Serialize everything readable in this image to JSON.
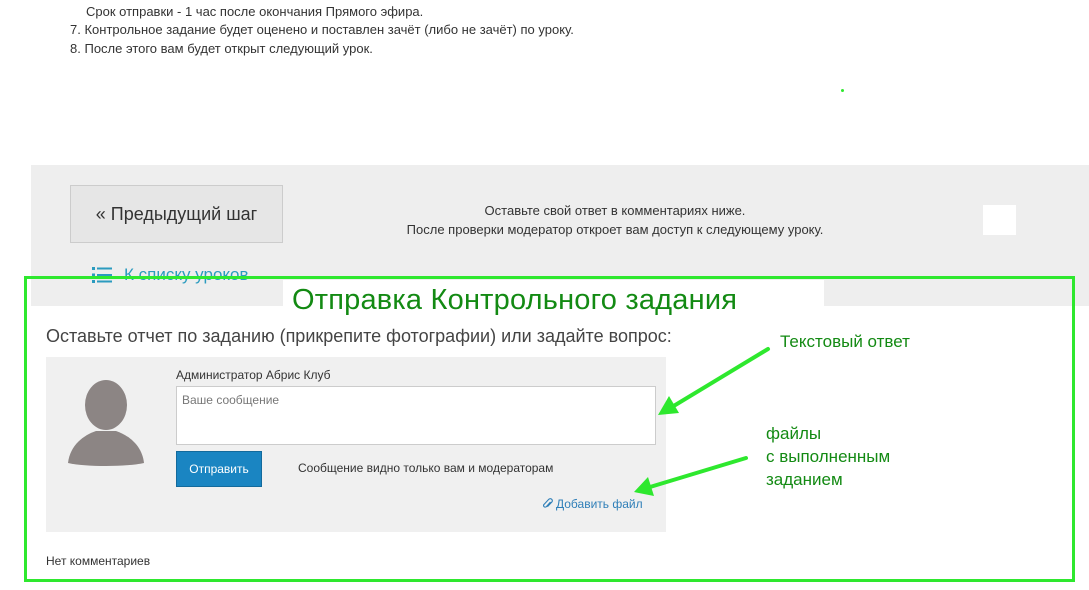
{
  "instructions": [
    {
      "number": "",
      "text": "Срок отправки - 1 час после окончания Прямого эфира."
    },
    {
      "number": "7.",
      "text": "Контрольное задание будет оценено и поставлен зачёт (либо не зачёт) по уроку."
    },
    {
      "number": "8.",
      "text": "После этого вам будет открыт следующий урок."
    }
  ],
  "nav": {
    "prev_label": "« Предыдущий шаг",
    "message_line1": "Оставьте свой ответ в комментариях ниже.",
    "message_line2": "После проверки модератор откроет вам доступ к следующему уроку.",
    "lessons_link": "К списку уроков"
  },
  "section": {
    "title": "Отправка Контрольного задания",
    "heading": "Оставьте отчет по заданию (прикрепите фотографии) или задайте вопрос:"
  },
  "comment_form": {
    "author": "Администратор Абрис Клуб",
    "placeholder": "Ваше сообщение",
    "send_label": "Отправить",
    "visibility_note": "Сообщение видно только вам и модераторам",
    "add_file_label": "Добавить файл"
  },
  "comments": {
    "empty_label": "Нет комментариев"
  },
  "annotations": {
    "text_answer": "Текстовый ответ",
    "files_line1": "файлы",
    "files_line2": "с выполненным",
    "files_line3": "заданием"
  },
  "colors": {
    "accent_green": "#2ee82e",
    "annotation_text": "#138a13",
    "link_blue": "#2b9bbf",
    "button_blue": "#1a85c2"
  }
}
